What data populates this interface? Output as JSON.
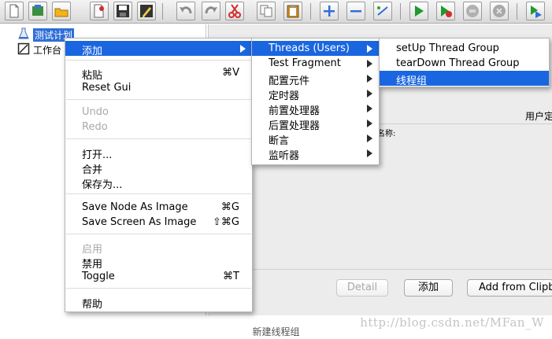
{
  "toolbar": {
    "buttons": [
      "new-icon",
      "templates-icon",
      "open-icon",
      "open-recent-icon",
      "save-icon",
      "save-as-icon",
      "undo-icon",
      "redo-icon",
      "cut-icon",
      "copy-icon",
      "paste-icon",
      "expand-icon",
      "collapse-icon",
      "toggle-icon",
      "start-icon",
      "start-no-pause-icon",
      "stop-icon",
      "shutdown-icon",
      "remote-start-icon"
    ]
  },
  "tree": {
    "test_plan": "测试计划",
    "workbench": "工作台"
  },
  "right_pane": {
    "user_defined": "用户定",
    "name_label": "名称:",
    "buttons": {
      "detail": "Detail",
      "add": "添加",
      "add_from_clipboard": "Add from Clipb"
    }
  },
  "context_menu": {
    "add": "添加",
    "paste": "粘贴",
    "paste_shortcut": "⌘V",
    "reset_gui": "Reset Gui",
    "undo": "Undo",
    "redo": "Redo",
    "open": "打开...",
    "merge": "合并",
    "save_as": "保存为...",
    "save_node_as_image": "Save Node As Image",
    "save_node_shortcut": "⌘G",
    "save_screen_as_image": "Save Screen As Image",
    "save_screen_shortcut": "⇧⌘G",
    "enable": "启用",
    "disable": "禁用",
    "toggle": "Toggle",
    "toggle_shortcut": "⌘T",
    "help": "帮助"
  },
  "add_submenu": {
    "threads_users": "Threads (Users)",
    "test_fragment": "Test Fragment",
    "config_element": "配置元件",
    "timer": "定时器",
    "pre_processors": "前置处理器",
    "post_processors": "后置处理器",
    "assertions": "断言",
    "listener": "监听器"
  },
  "threads_submenu": {
    "setup_thread_group": "setUp Thread Group",
    "teardown_thread_group": "tearDown Thread Group",
    "thread_group": "线程组"
  },
  "caption": "新建线程组",
  "watermark": "http://blog.csdn.net/MFan_W"
}
